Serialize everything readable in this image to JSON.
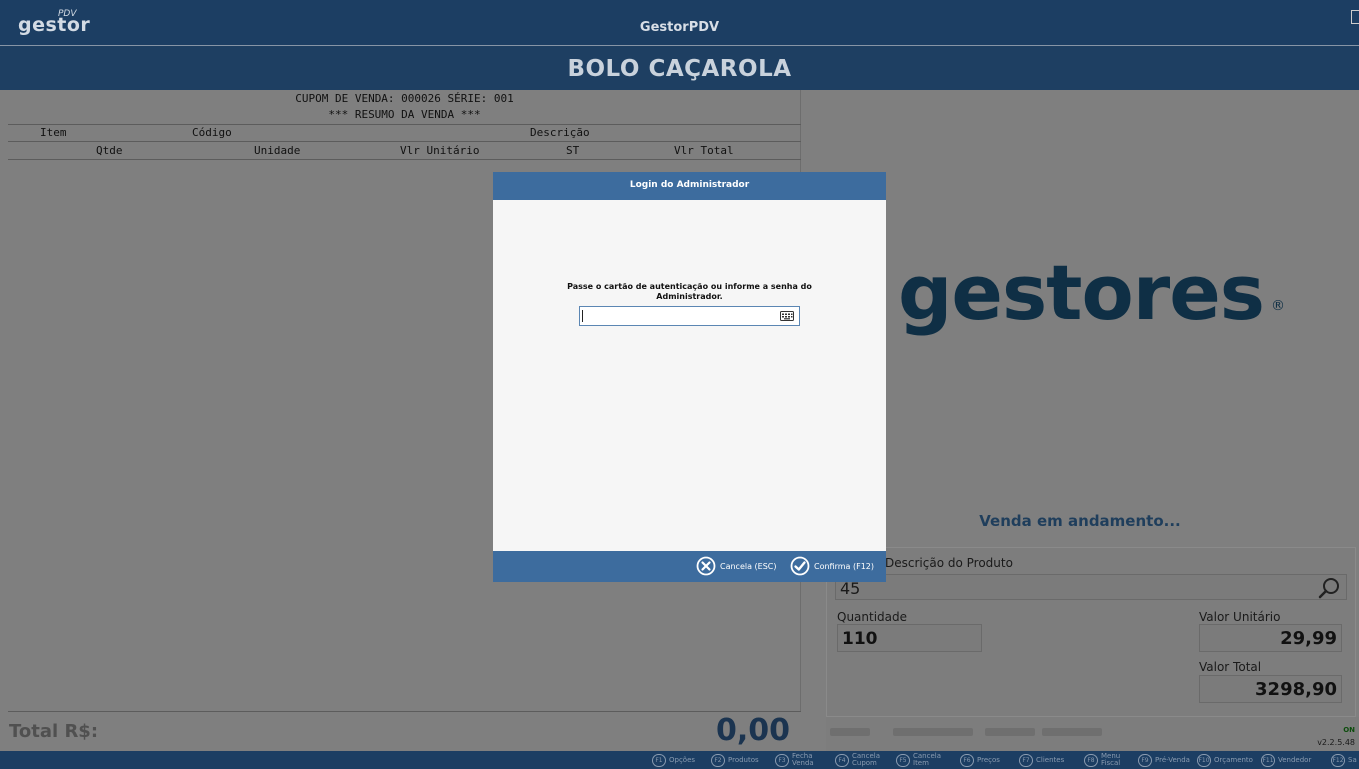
{
  "titlebar": {
    "logo": "gestor",
    "logo_sup": "PDV",
    "title": "GestorPDV"
  },
  "store": {
    "name": "BOLO CAÇAROLA"
  },
  "receipt": {
    "line1": "CUPOM DE VENDA: 000026  SÉRIE: 001",
    "line2": "*** RESUMO DA VENDA ***",
    "header_row1": [
      "Item",
      "Código",
      "Descrição"
    ],
    "header_row2": [
      "Qtde",
      "Unidade",
      "Vlr Unitário",
      "ST",
      "Vlr Total"
    ]
  },
  "total": {
    "label": "Total R$:",
    "value": "0,00"
  },
  "brand": {
    "text": "gestores",
    "reg": "®"
  },
  "status": "Venda em andamento...",
  "product": {
    "desc_label": "Descrição do Produto",
    "desc_value": "45",
    "qty_label": "Quantidade",
    "qty_value": "110",
    "unit_label": "Valor Unitário",
    "unit_value": "29,99",
    "total_label": "Valor Total",
    "total_value": "3298,90"
  },
  "footer": {
    "online": "ON",
    "version": "v2.2.5.48"
  },
  "keys": [
    {
      "key": "F1",
      "label": "Opções"
    },
    {
      "key": "F2",
      "label": "Produtos"
    },
    {
      "key": "F3",
      "label": "Fecha Venda"
    },
    {
      "key": "F4",
      "label": "Cancela Cupom"
    },
    {
      "key": "F5",
      "label": "Cancela Item"
    },
    {
      "key": "F6",
      "label": "Preços"
    },
    {
      "key": "F7",
      "label": "Clientes"
    },
    {
      "key": "F8",
      "label": "Menu Fiscal"
    },
    {
      "key": "F9",
      "label": "Pré-Venda"
    },
    {
      "key": "F10",
      "label": "Orçamento"
    },
    {
      "key": "F11",
      "label": "Vendedor"
    },
    {
      "key": "F12",
      "label": "Sa"
    }
  ],
  "modal": {
    "title": "Login do Administrador",
    "message": "Passe o cartão de autenticação ou informe a senha do Administrador.",
    "password_value": "",
    "cancel_label": "Cancela (ESC)",
    "confirm_label": "Confirma (F12)"
  },
  "colors": {
    "header_bg": "#1c3e63",
    "modal_accent": "#3d6c9e",
    "overlay_gray": "#7f7f7f"
  },
  "icons": [
    "search-icon",
    "keyboard-icon",
    "cancel-icon",
    "confirm-icon"
  ]
}
